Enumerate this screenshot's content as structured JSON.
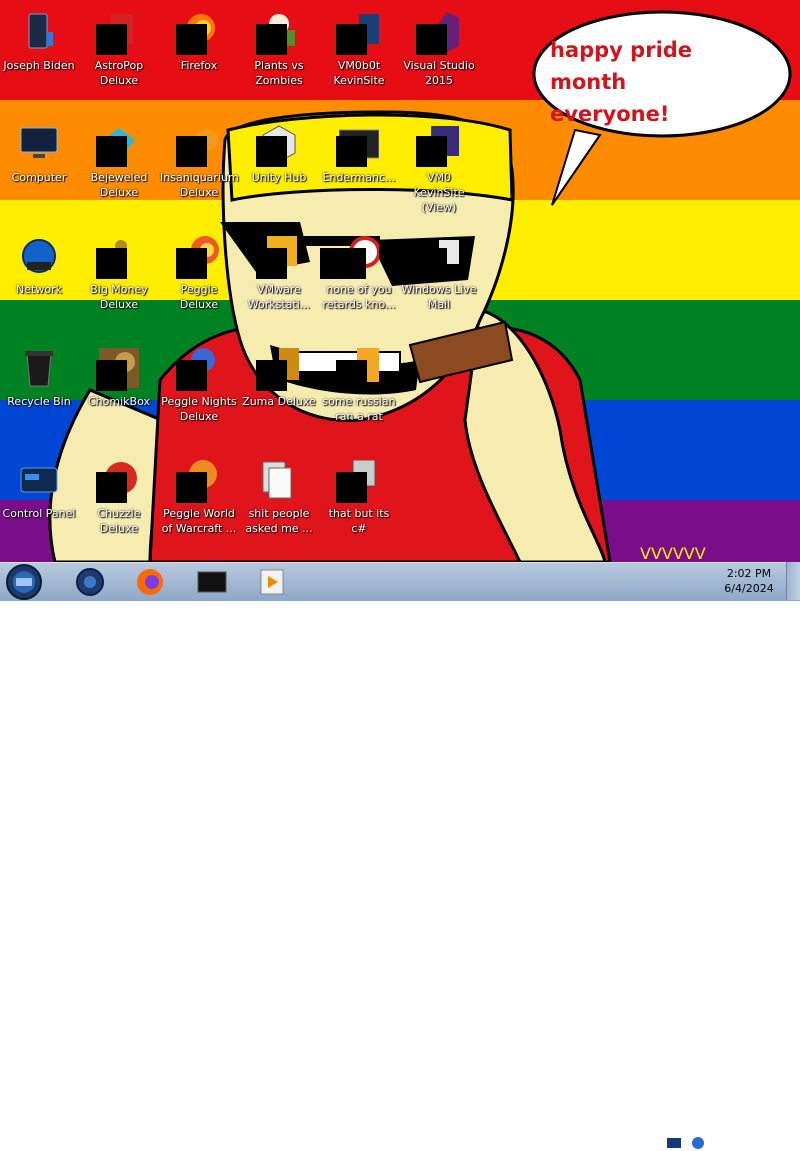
{
  "speech_bubble": {
    "line1": "happy pride month",
    "line2": "everyone!"
  },
  "desktop_icons": [
    {
      "label": "Joseph Biden"
    },
    {
      "label": "AstroPop Deluxe"
    },
    {
      "label": "Firefox"
    },
    {
      "label": "Plants vs Zombies"
    },
    {
      "label": "VM0b0t KevinSite"
    },
    {
      "label": "Visual Studio 2015"
    },
    {
      "label": "Computer"
    },
    {
      "label": "Bejeweled Deluxe"
    },
    {
      "label": "Insaniquarium Deluxe"
    },
    {
      "label": "Unity Hub"
    },
    {
      "label": "Endermanc..."
    },
    {
      "label": "VM0 KevinSite (View)"
    },
    {
      "label": "Network"
    },
    {
      "label": "Big Money Deluxe"
    },
    {
      "label": "Peggle Deluxe"
    },
    {
      "label": "VMware Workstati..."
    },
    {
      "label": "none of you retards kno..."
    },
    {
      "label": "Windows Live Mail"
    },
    {
      "label": "Recycle Bin"
    },
    {
      "label": "ChomikBox"
    },
    {
      "label": "Peggle Nights Deluxe"
    },
    {
      "label": "Zuma Deluxe"
    },
    {
      "label": "some russian ran a rat"
    },
    {
      "label": "Control Panel"
    },
    {
      "label": "Chuzzle Deluxe"
    },
    {
      "label": "Peggle World of Warcraft ..."
    },
    {
      "label": "shit people asked me ..."
    },
    {
      "label": "that but its c#"
    }
  ],
  "taskbar": {
    "pinned": [
      "start-orb",
      "blue-orb-app",
      "firefox",
      "black-box-app",
      "media-player"
    ],
    "clock": {
      "time": "2:02 PM",
      "date": "6/4/2024"
    }
  },
  "colors": {
    "stripe_red": "#e60d14",
    "stripe_orange": "#ff8c00",
    "stripe_yellow": "#ffee00",
    "stripe_green": "#018222",
    "stripe_blue": "#0046d4",
    "stripe_purple": "#7a0d8a",
    "speech_text": "#d2151c"
  }
}
